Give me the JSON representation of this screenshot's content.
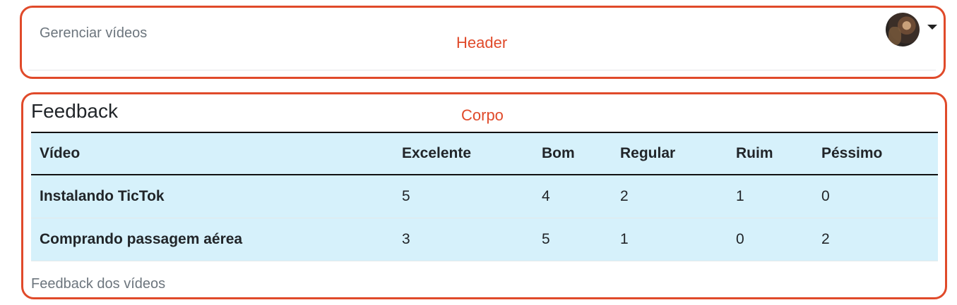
{
  "annotations": {
    "header_label": "Header",
    "body_label": "Corpo"
  },
  "header": {
    "title": "Gerenciar vídeos",
    "avatar_icon": "user-avatar",
    "menu_icon": "caret-down-icon"
  },
  "main": {
    "title": "Feedback",
    "caption": "Feedback dos vídeos",
    "table": {
      "columns": [
        "Vídeo",
        "Excelente",
        "Bom",
        "Regular",
        "Ruim",
        "Péssimo"
      ],
      "rows": [
        [
          "Instalando TicTok",
          "5",
          "4",
          "2",
          "1",
          "0"
        ],
        [
          "Comprando passagem aérea",
          "3",
          "5",
          "1",
          "0",
          "2"
        ]
      ]
    }
  },
  "colors": {
    "annotation": "#e04a2a",
    "table_bg": "#d6f1fb",
    "muted_text": "#6c757d"
  }
}
